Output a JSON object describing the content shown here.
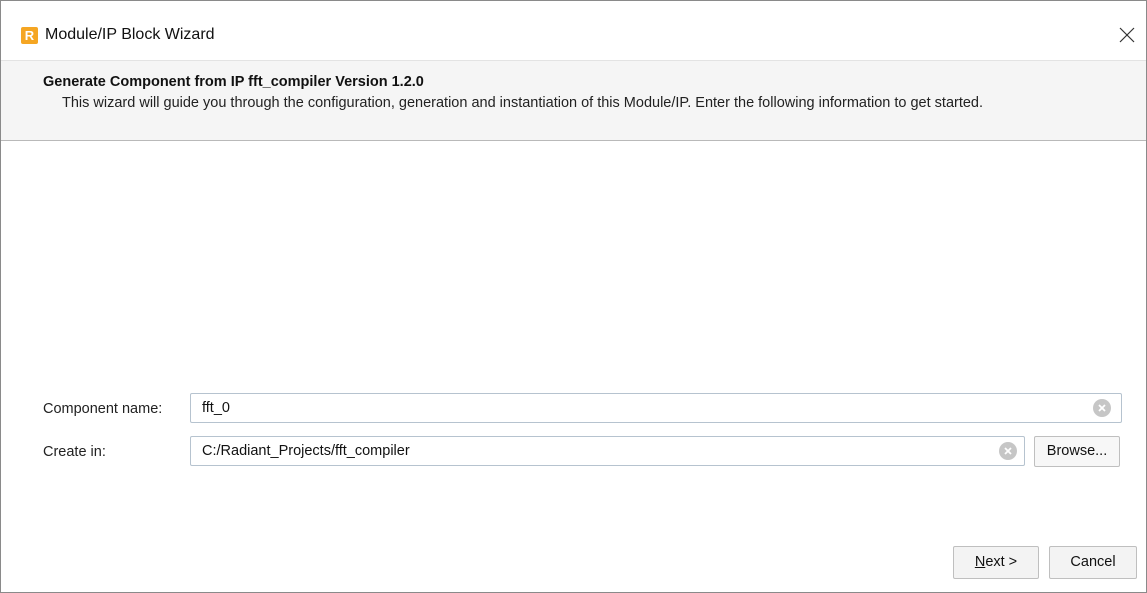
{
  "window": {
    "title": "Module/IP Block Wizard",
    "icon": "radiant-app-icon",
    "icon_letter": "R",
    "icon_color": "#f5a623"
  },
  "header": {
    "title": "Generate Component from IP fft_compiler Version 1.2.0",
    "description": "This wizard will guide you through the configuration, generation and instantiation of this Module/IP. Enter the following information to get started."
  },
  "form": {
    "component_name": {
      "label": "Component name:",
      "value": "fft_0"
    },
    "create_in": {
      "label": "Create in:",
      "value": "C:/Radiant_Projects/fft_compiler",
      "browse_label": "Browse..."
    }
  },
  "buttons": {
    "next_mnemonic": "N",
    "next_rest": "ext >",
    "cancel": "Cancel"
  },
  "colors": {
    "header_bg": "#f5f5f5",
    "field_border": "#b6c3cf",
    "button_bg": "#f3f3f3"
  }
}
